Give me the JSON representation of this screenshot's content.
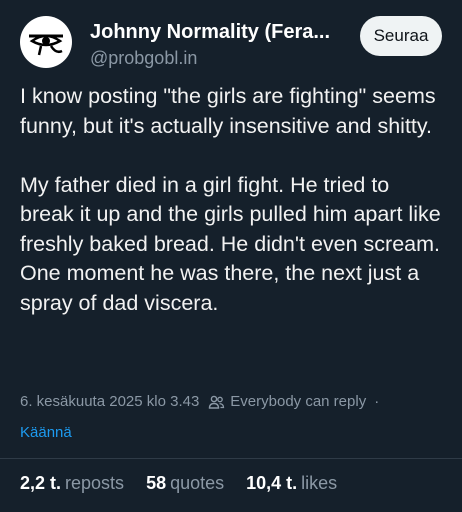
{
  "author": {
    "display_name": "Johnny Normality (Fera...",
    "handle": "@probgobl.in",
    "avatar_icon": "eye-of-horus-icon"
  },
  "follow_button": {
    "label": "Seuraa"
  },
  "post": {
    "paragraphs": [
      "I know posting \"the girls are fighting\" seems funny, but it's actually insensitive and shitty.",
      "My father died in a girl fight. He tried to break it up and the girls pulled him apart like freshly baked bread. He didn't even scream. One moment he was there, the next just a spray of dad viscera."
    ],
    "timestamp": "6. kesäkuuta 2025 klo 3.43",
    "reply_setting": "Everybody can reply",
    "reply_icon": "people-icon",
    "separator": "·",
    "translate_label": "Käännä"
  },
  "stats": {
    "reposts": {
      "value": "2,2 t.",
      "label": "reposts"
    },
    "quotes": {
      "value": "58",
      "label": "quotes"
    },
    "likes": {
      "value": "10,4 t.",
      "label": "likes"
    }
  },
  "colors": {
    "background": "#15202b",
    "secondary_text": "#8b98a5",
    "link": "#1d9bf0",
    "button_bg": "#eff3f4"
  }
}
